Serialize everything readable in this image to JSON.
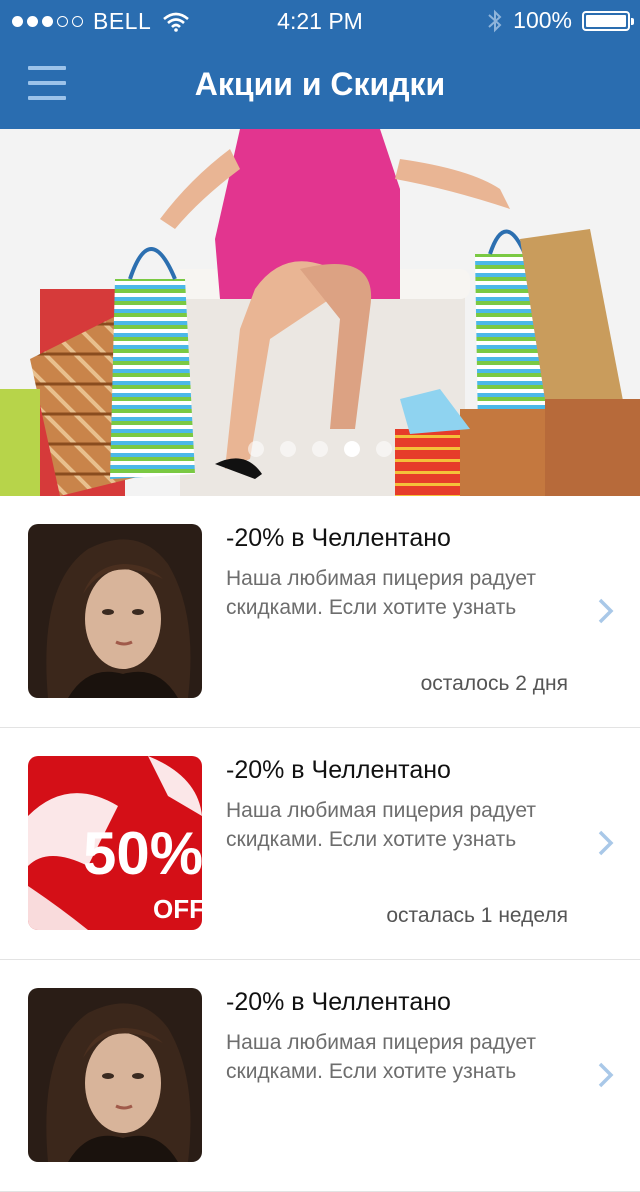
{
  "status_bar": {
    "carrier": "BELL",
    "time": "4:21 PM",
    "battery": "100%"
  },
  "header": {
    "title": "Акции и Скидки"
  },
  "banner": {
    "pages": 5,
    "active_page": 4
  },
  "promos": [
    {
      "title": "-20% в Челлентано",
      "description": "Наша любимая пицерия радует скидками. Если хотите узнать",
      "time_left": "осталось 2 дня",
      "image": "portrait"
    },
    {
      "title": "-20% в Челлентано",
      "description": "Наша любимая пицерия радует скидками. Если хотите узнать",
      "time_left": "осталась 1 неделя",
      "image": "sale-50-off"
    },
    {
      "title": "-20% в Челлентано",
      "description": "Наша любимая пицерия радует скидками. Если хотите узнать",
      "time_left": "",
      "image": "portrait"
    }
  ],
  "sale_badge": {
    "percent": "50%",
    "off": "OFF"
  },
  "colors": {
    "header": "#2a6db0",
    "chevron": "#a9c8e8",
    "sale_red": "#d40f17"
  }
}
